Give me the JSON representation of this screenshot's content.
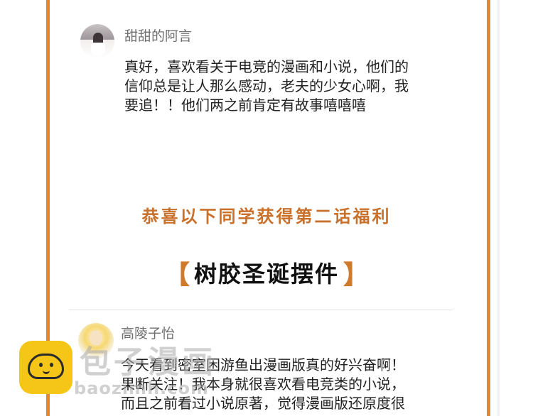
{
  "comments": [
    {
      "username": "甜甜的阿言",
      "lines": [
        "真好，喜欢看关于电竞的漫画和小说，他们的",
        "信仰总是让人那么感动，老夫的少女心啊，我",
        "要追！！他们两之前肯定有故事嘻嘻嘻"
      ]
    },
    {
      "username": "高陵子怡",
      "lines": [
        "今天看到密室困游鱼出漫画版真的好兴奋啊！",
        "果断关注！我本身就很喜欢看电竞类的小说，",
        "而且之前看过小说原著，觉得漫画版还原度很"
      ]
    }
  ],
  "congrats_text": "恭喜以下同学获得第二话福利",
  "prize": {
    "open_bracket": "【",
    "name": "树胶圣诞摆件",
    "close_bracket": "】"
  },
  "watermark": {
    "title": "包子漫画",
    "url": "baozimh.com"
  },
  "colors": {
    "frame": "#e6862e",
    "accent_text": "#c9702a",
    "watermark_logo": "#f5c518"
  }
}
